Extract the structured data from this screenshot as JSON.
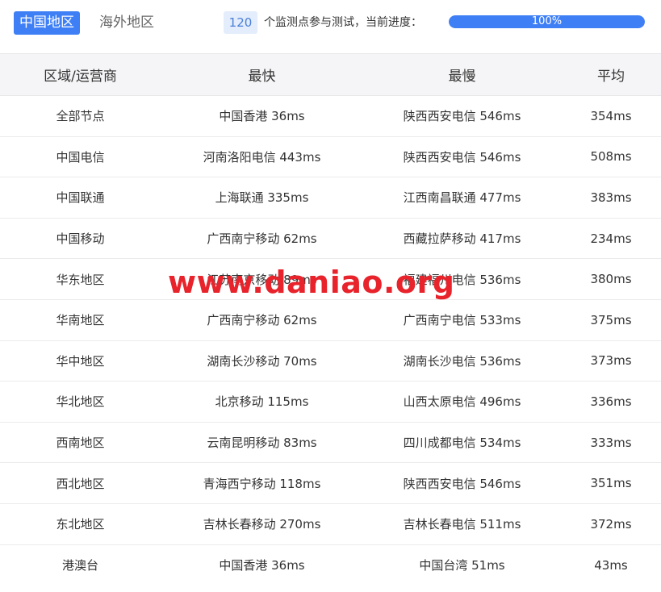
{
  "tabs": {
    "active": "中国地区",
    "inactive": "海外地区"
  },
  "progress": {
    "count": "120",
    "label": "个监测点参与测试，当前进度：",
    "percent_text": "100%",
    "fraction": 1.0,
    "fill_color": "#3f7ff5"
  },
  "table": {
    "headers": [
      "区域/运营商",
      "最快",
      "最慢",
      "平均"
    ],
    "rows": [
      {
        "region": "全部节点",
        "fastest": "中国香港 36ms",
        "slowest": "陕西西安电信 546ms",
        "average": "354ms"
      },
      {
        "region": "中国电信",
        "fastest": "河南洛阳电信 443ms",
        "slowest": "陕西西安电信 546ms",
        "average": "508ms"
      },
      {
        "region": "中国联通",
        "fastest": "上海联通 335ms",
        "slowest": "江西南昌联通 477ms",
        "average": "383ms"
      },
      {
        "region": "中国移动",
        "fastest": "广西南宁移动 62ms",
        "slowest": "西藏拉萨移动 417ms",
        "average": "234ms"
      },
      {
        "region": "华东地区",
        "fastest": "江苏南京移动 89ms",
        "slowest": "福建福州电信 536ms",
        "average": "380ms"
      },
      {
        "region": "华南地区",
        "fastest": "广西南宁移动 62ms",
        "slowest": "广西南宁电信 533ms",
        "average": "375ms"
      },
      {
        "region": "华中地区",
        "fastest": "湖南长沙移动 70ms",
        "slowest": "湖南长沙电信 536ms",
        "average": "373ms"
      },
      {
        "region": "华北地区",
        "fastest": "北京移动 115ms",
        "slowest": "山西太原电信 496ms",
        "average": "336ms"
      },
      {
        "region": "西南地区",
        "fastest": "云南昆明移动 83ms",
        "slowest": "四川成都电信 534ms",
        "average": "333ms"
      },
      {
        "region": "西北地区",
        "fastest": "青海西宁移动 118ms",
        "slowest": "陕西西安电信 546ms",
        "average": "351ms"
      },
      {
        "region": "东北地区",
        "fastest": "吉林长春移动 270ms",
        "slowest": "吉林长春电信 511ms",
        "average": "372ms"
      },
      {
        "region": "港澳台",
        "fastest": "中国香港 36ms",
        "slowest": "中国台湾 51ms",
        "average": "43ms"
      }
    ]
  },
  "watermark": "www.daniao.org"
}
